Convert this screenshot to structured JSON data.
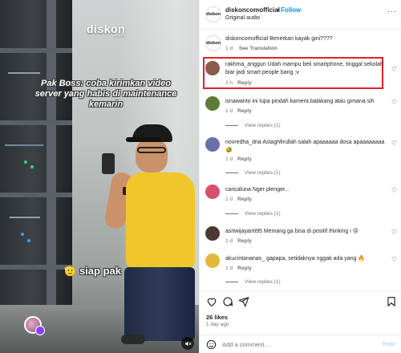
{
  "video": {
    "brand_logo": "diskon",
    "brand_sub": ".com",
    "caption": "Pak Boss: coba kirimkan video server yang habis di maintenance kemarin",
    "bottom_text": "siap pak",
    "bottom_emoji": "🫡"
  },
  "header": {
    "avatar_text": "diskon",
    "username": "diskoncomofficial",
    "separator": "•",
    "follow_label": "Follow",
    "audio": "Original audio",
    "more": "···"
  },
  "caption_comment": {
    "avatar_text": "diskon",
    "text": "diskoncomofficial Benerkan kayak gini????",
    "time": "1 d",
    "translation": "See Translation"
  },
  "comments": [
    {
      "text": "rakhma_anggun Udah mampu beli smartphone, tinggal sekolah biar jadi smart people bang :v",
      "time": "2 h",
      "reply": "Reply",
      "avatar_color": "#8b5a4a"
    },
    {
      "text": "isnawanto ini lupa pindah kamera balakang atau gimana sih",
      "time": "1 d",
      "reply": "Reply",
      "view_replies": "View replies (1)",
      "avatar_color": "#5d7a3a"
    },
    {
      "text": "novredha_dna Astaghfirullah salah apaaaaaa dosa apaaaaaaaa 🤣",
      "time": "1 d",
      "reply": "Reply",
      "view_replies": "View replies (1)",
      "avatar_color": "#6a6fa8"
    },
    {
      "text": "caricaluna Nger plenger...",
      "time": "1 d",
      "reply": "Reply",
      "view_replies": "View replies (1)",
      "avatar_color": "#d84f6a"
    },
    {
      "text": "asriwijayanti95 Memang ga bisa di positif thinking i 😢",
      "time": "1 d",
      "reply": "Reply",
      "avatar_color": "#4a3a34"
    },
    {
      "text": "akucintananas_ gapapa, setidaknya nggak ada yang 🔥",
      "time": "1 d",
      "reply": "Reply",
      "view_replies": "View replies (1)",
      "avatar_color": "#e0b93a"
    }
  ],
  "footer": {
    "likes": "26 likes",
    "time_ago": "1 day ago",
    "comment_placeholder": "Add a comment…",
    "post_label": "Post"
  },
  "colors": {
    "follow": "#0095f6",
    "highlight": "#e3202a",
    "shirt": "#f1c62a"
  },
  "icons": [
    "heart-icon",
    "comment-icon",
    "share-icon",
    "save-icon",
    "emoji-icon",
    "mute-icon",
    "more-icon"
  ]
}
